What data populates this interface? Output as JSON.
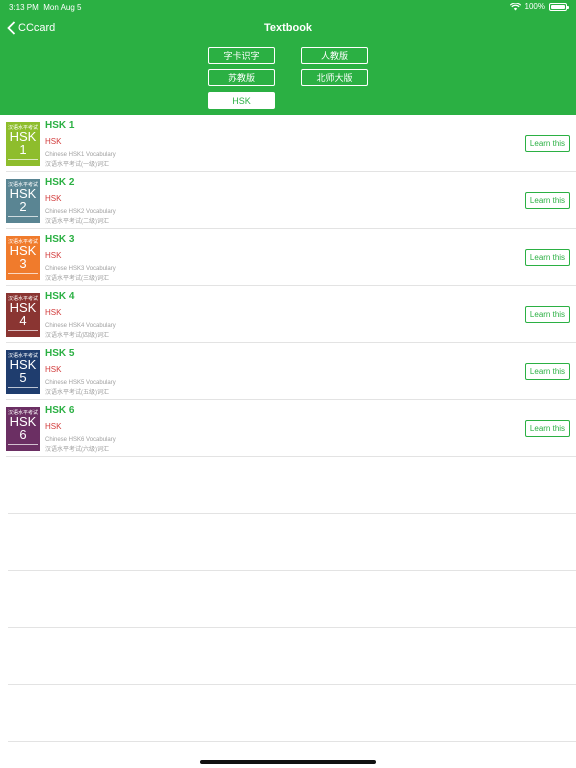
{
  "status_bar": {
    "time": "3:13 PM",
    "date": "Mon Aug 5",
    "battery": "100%"
  },
  "nav": {
    "back_label": "CCcard",
    "title": "Textbook"
  },
  "filters": [
    "字卡识字",
    "人教版",
    "苏教版",
    "北师大版",
    "HSK"
  ],
  "active_filter": "HSK",
  "learn_label": "Learn this",
  "items": [
    {
      "name": "HSK 1",
      "tag": "HSK",
      "desc_en": "Chinese HSK1 Vocabulary",
      "desc_cn": "汉语水平考试(一级)词汇",
      "cover_cn": "汉语水平考试",
      "cover_text": "HSK",
      "cover_num": "1",
      "cover_color": "#8ebd2c"
    },
    {
      "name": "HSK 2",
      "tag": "HSK",
      "desc_en": "Chinese HSK2 Vocabulary",
      "desc_cn": "汉语水平考试(二级)词汇",
      "cover_cn": "汉语水平考试",
      "cover_text": "HSK",
      "cover_num": "2",
      "cover_color": "#5a8593"
    },
    {
      "name": "HSK 3",
      "tag": "HSK",
      "desc_en": "Chinese HSK3 Vocabulary",
      "desc_cn": "汉语水平考试(三级)词汇",
      "cover_cn": "汉语水平考试",
      "cover_text": "HSK",
      "cover_num": "3",
      "cover_color": "#f07b2c"
    },
    {
      "name": "HSK 4",
      "tag": "HSK",
      "desc_en": "Chinese HSK4 Vocabulary",
      "desc_cn": "汉语水平考试(四级)词汇",
      "cover_cn": "汉语水平考试",
      "cover_text": "HSK",
      "cover_num": "4",
      "cover_color": "#8a3532"
    },
    {
      "name": "HSK 5",
      "tag": "HSK",
      "desc_en": "Chinese HSK5 Vocabulary",
      "desc_cn": "汉语水平考试(五级)词汇",
      "cover_cn": "汉语水平考试",
      "cover_text": "HSK",
      "cover_num": "5",
      "cover_color": "#1f3d6e"
    },
    {
      "name": "HSK 6",
      "tag": "HSK",
      "desc_en": "Chinese HSK6 Vocabulary",
      "desc_cn": "汉语水平考试(六级)词汇",
      "cover_cn": "汉语水平考试",
      "cover_text": "HSK",
      "cover_num": "6",
      "cover_color": "#6b2f63"
    }
  ],
  "colors": {
    "accent": "#2bb043",
    "tag": "#d23a3a"
  }
}
